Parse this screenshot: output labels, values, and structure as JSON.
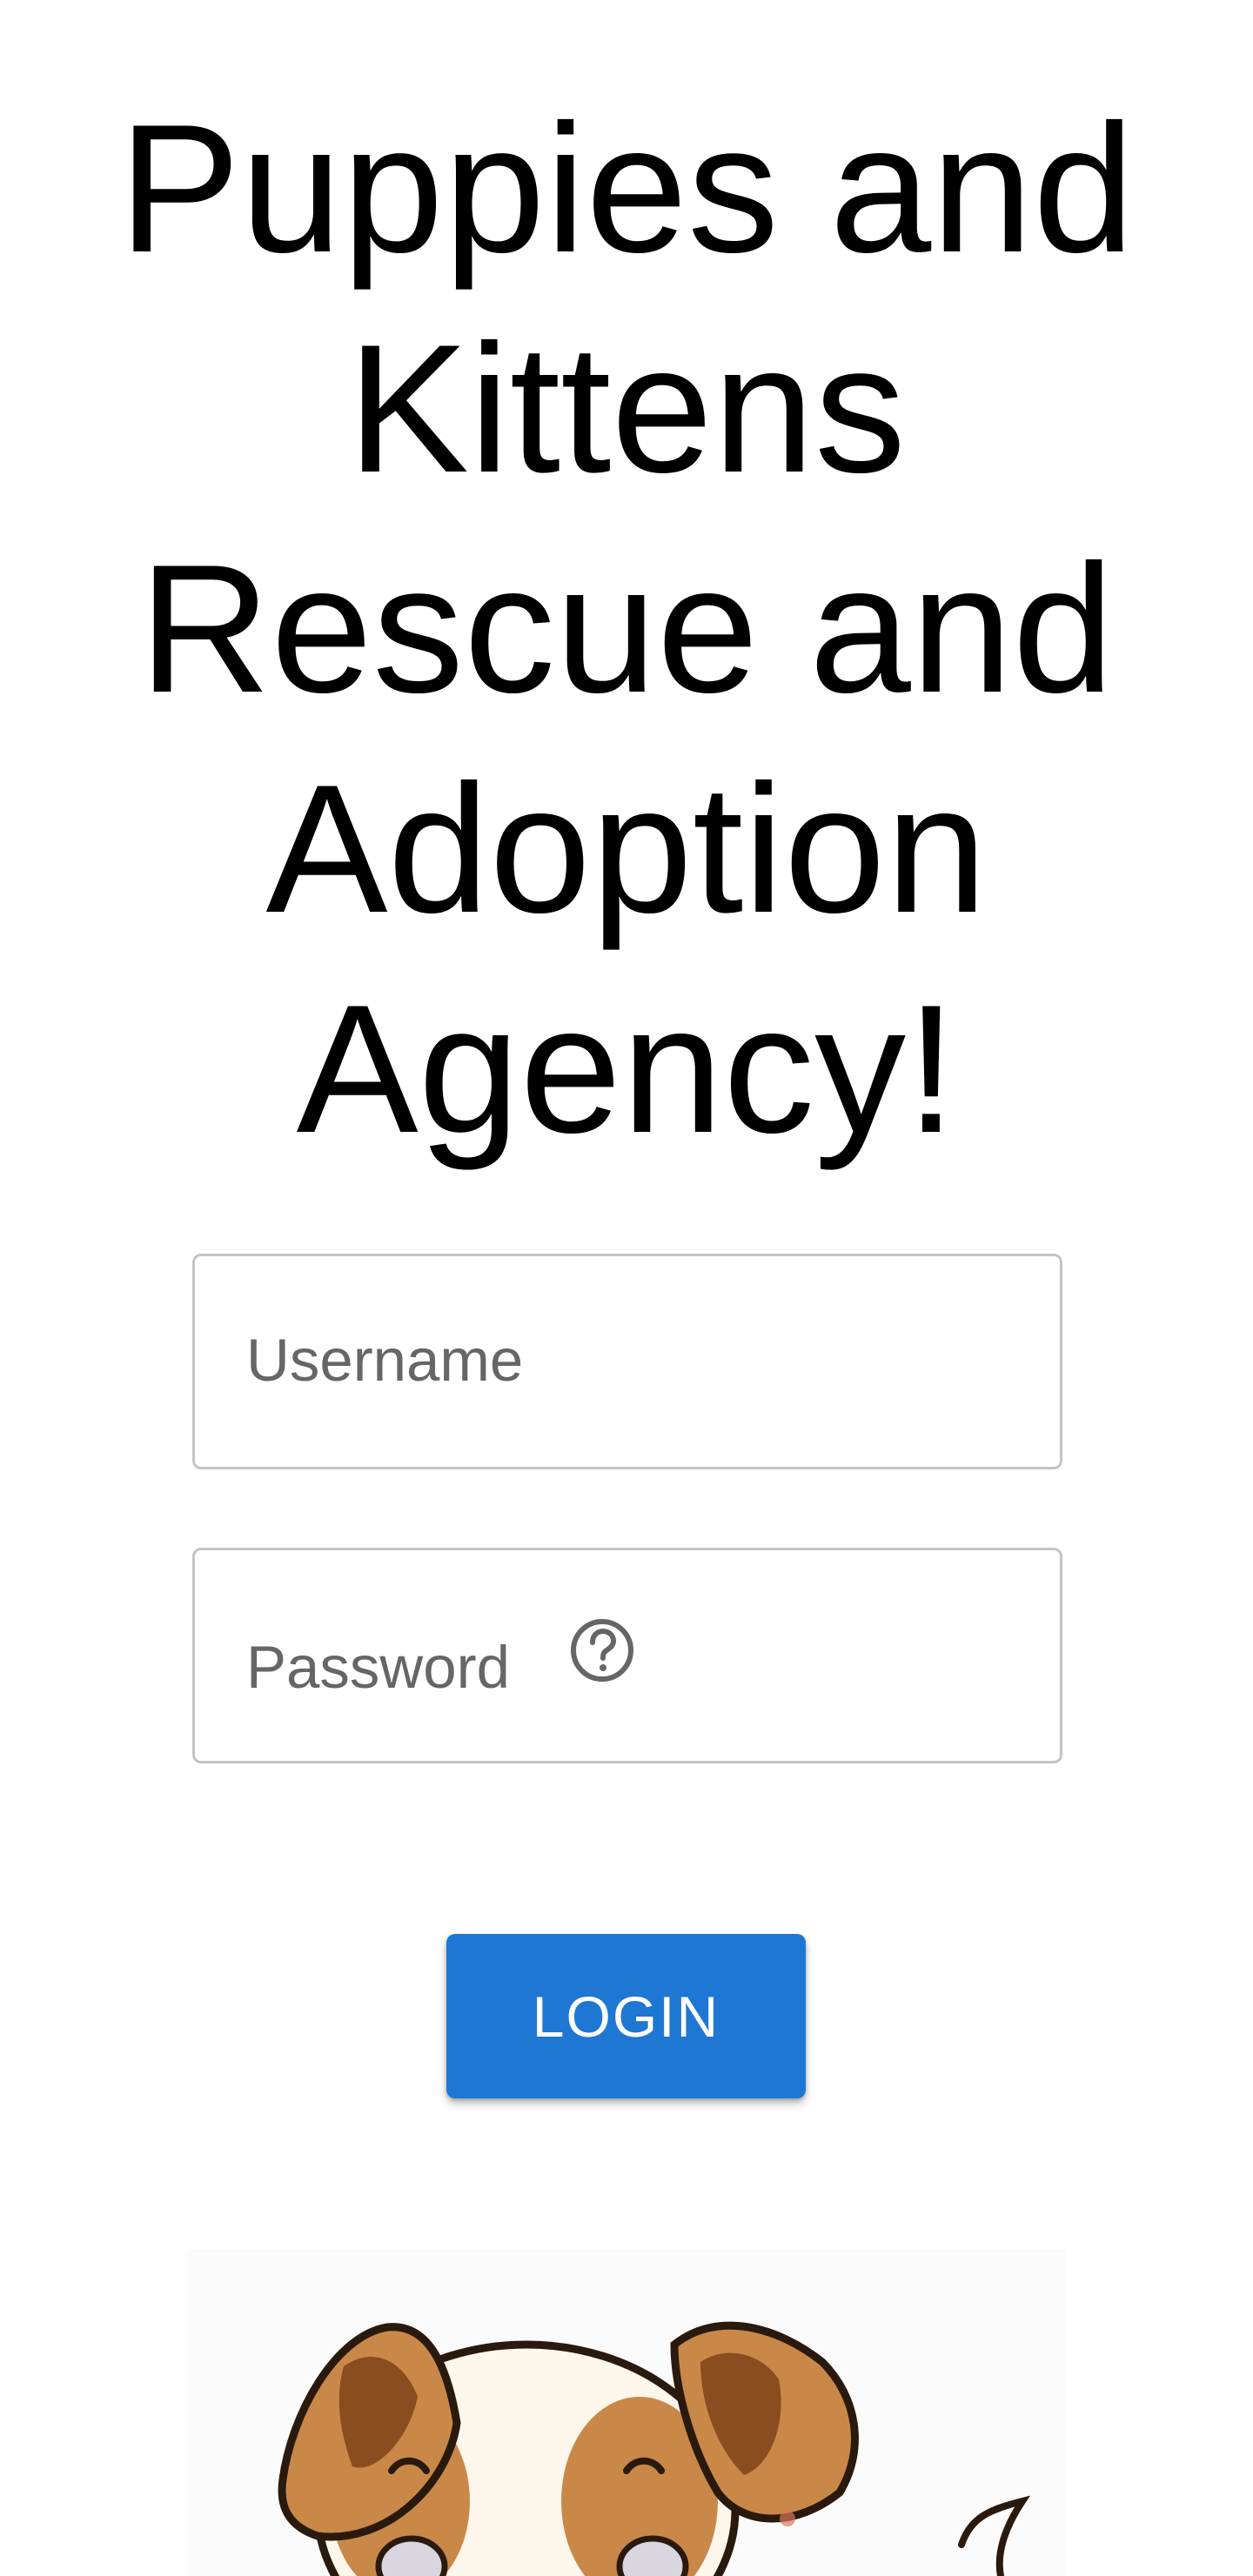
{
  "page": {
    "title_lines": [
      "Puppies and",
      "Kittens",
      "Rescue and",
      "Adoption",
      "Agency!"
    ]
  },
  "login_form": {
    "username_placeholder": "Username",
    "password_placeholder": "Password",
    "help_icon": "question-circle-icon",
    "login_label": "LOGIN"
  },
  "colors": {
    "accent": "#1e77d3",
    "field_border": "#c4c4c4",
    "placeholder_text": "#666666",
    "mascot_fur": "#c98848",
    "mascot_outline": "#2a1a0e"
  },
  "mascot": {
    "icon": "puppy-illustration"
  }
}
